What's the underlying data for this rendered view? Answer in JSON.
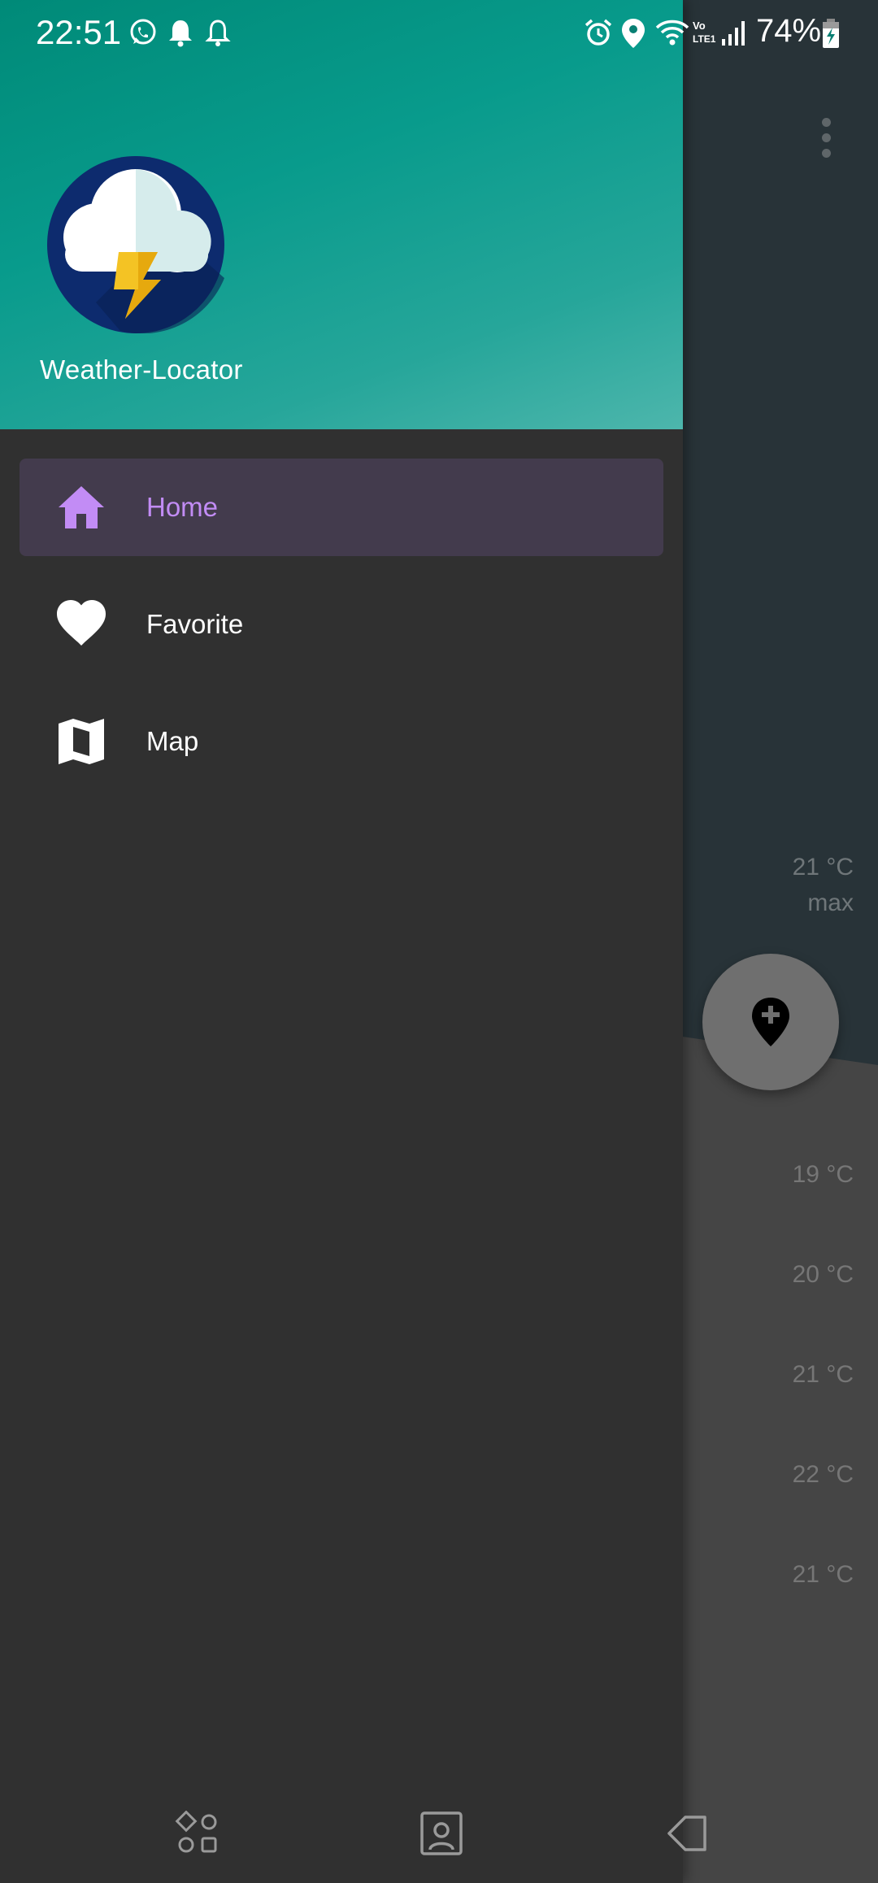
{
  "status_bar": {
    "time": "22:51",
    "battery_percent": "74%",
    "network_label": "Vo LTE1",
    "icons": [
      "whatsapp-icon",
      "bell-filled-icon",
      "bell-outline-icon",
      "alarm-icon",
      "location-icon",
      "wifi-icon",
      "volte-icon",
      "signal-icon",
      "battery-charging-icon"
    ]
  },
  "drawer": {
    "app_name": "Weather-Locator",
    "logo_icon": "storm-cloud-icon",
    "menu": [
      {
        "label": "Home",
        "icon": "home-icon",
        "active": true
      },
      {
        "label": "Favorite",
        "icon": "heart-icon",
        "active": false
      },
      {
        "label": "Map",
        "icon": "map-icon",
        "active": false
      }
    ],
    "colors": {
      "header_start": "#008a78",
      "header_end": "#4db6ac",
      "active_text": "#c28cf5",
      "active_bg": "#433b4d",
      "body": "#303030"
    }
  },
  "background_app": {
    "max_temp": "21 °C",
    "max_label": "max",
    "fab_icon": "add-location-icon",
    "hourly_temps": [
      "19 °C",
      "20 °C",
      "21 °C",
      "22 °C",
      "21 °C"
    ]
  },
  "nav_bar": {
    "icons": [
      "recent-apps-icon",
      "home-nav-icon",
      "back-icon"
    ]
  }
}
